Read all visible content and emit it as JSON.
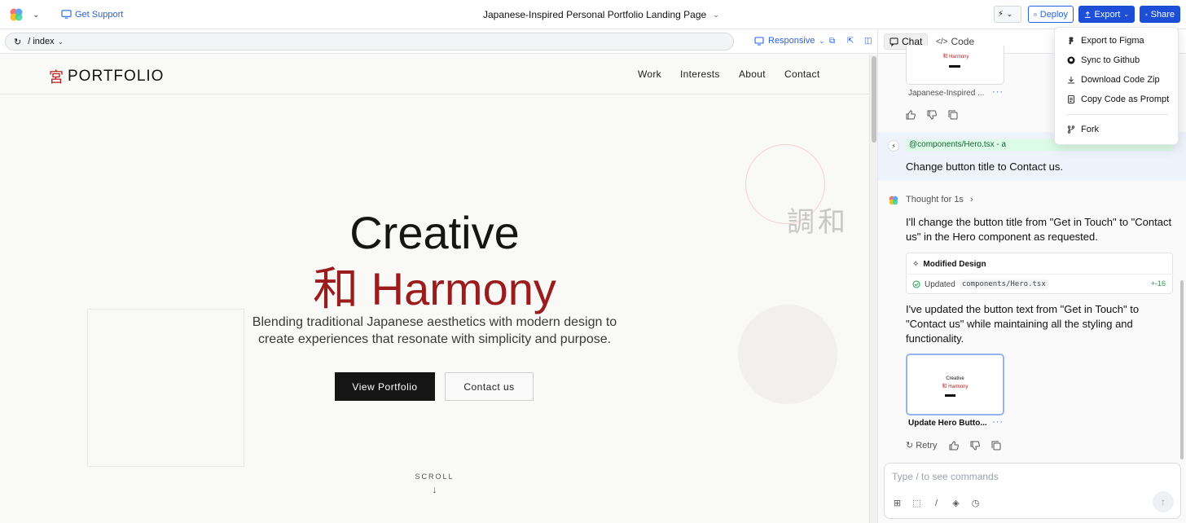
{
  "topbar": {
    "support_label": "Get Support",
    "project_title": "Japanese-Inspired Personal Portfolio Landing Page",
    "deploy_label": "Deploy",
    "export_label": "Export",
    "share_label": "Share"
  },
  "addressbar": {
    "path": "/ index",
    "viewport_label": "Responsive"
  },
  "site": {
    "brand_kanji": "宮",
    "brand_name": "PORTFOLIO",
    "nav": [
      "Work",
      "Interests",
      "About",
      "Contact"
    ],
    "deco_kanji": "調和",
    "hero_line1": "Creative",
    "hero_line2": "和 Harmony",
    "hero_sub": "Blending traditional Japanese aesthetics with modern design to create experiences that resonate with simplicity and purpose.",
    "cta_primary": "View Portfolio",
    "cta_secondary": "Contact us",
    "scroll_label": "SCROLL",
    "scroll_arrow": "↓"
  },
  "chat": {
    "tab_chat": "Chat",
    "tab_code": "Code",
    "prev_thumb": {
      "title": "和 Harmony",
      "caption": "Japanese-Inspired ..."
    },
    "user_mention": "@components/Hero.tsx - a",
    "user_message": "Change button title to Contact us.",
    "thought": "Thought for 1s",
    "ai_message_1": "I'll change the button title from \"Get in Touch\" to \"Contact us\" in the Hero component as requested.",
    "modified_header": "Modified Design",
    "modified_prefix": "Updated",
    "modified_file": "components/Hero.tsx",
    "modified_diff": "+-16",
    "ai_message_2": "I've updated the button text from \"Get in Touch\" to \"Contact us\" while maintaining all the styling and functionality.",
    "thumb2": {
      "line1": "Creative",
      "line2": "和 Harmony",
      "caption": "Update Hero Butto..."
    },
    "retry_label": "Retry",
    "input_placeholder": "Type / to see commands"
  },
  "export_menu": {
    "items": [
      "Export to Figma",
      "Sync to Github",
      "Download Code Zip",
      "Copy Code as Prompt",
      "Fork"
    ]
  },
  "colors": {
    "accent": "#1d4ed8",
    "brand_red": "#9b1c1c",
    "link_blue": "#2563eb"
  }
}
